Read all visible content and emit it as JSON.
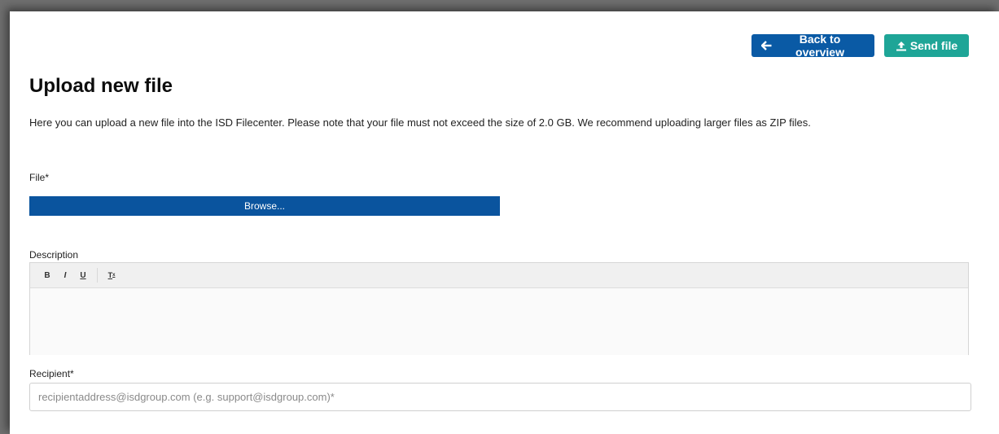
{
  "header": {
    "back_label": "Back to overview",
    "send_label": "Send file",
    "back_icon": "arrow-left-icon",
    "send_icon": "upload-icon"
  },
  "page": {
    "title": "Upload new file",
    "intro": "Here you can upload a new file into the ISD Filecenter. Please note that your file must not exceed the size of 2.0 GB. We recommend uploading larger files as ZIP files."
  },
  "file": {
    "label": "File*",
    "browse_label": "Browse..."
  },
  "description": {
    "label": "Description",
    "toolbar": {
      "bold": "B",
      "italic": "I",
      "underline": "U",
      "clear_format": "T"
    }
  },
  "recipient": {
    "label": "Recipient*",
    "placeholder": "recipientaddress@isdgroup.com (e.g. support@isdgroup.com)*",
    "value": ""
  },
  "colors": {
    "primary": "#0a5aa5",
    "success": "#1ea597"
  }
}
